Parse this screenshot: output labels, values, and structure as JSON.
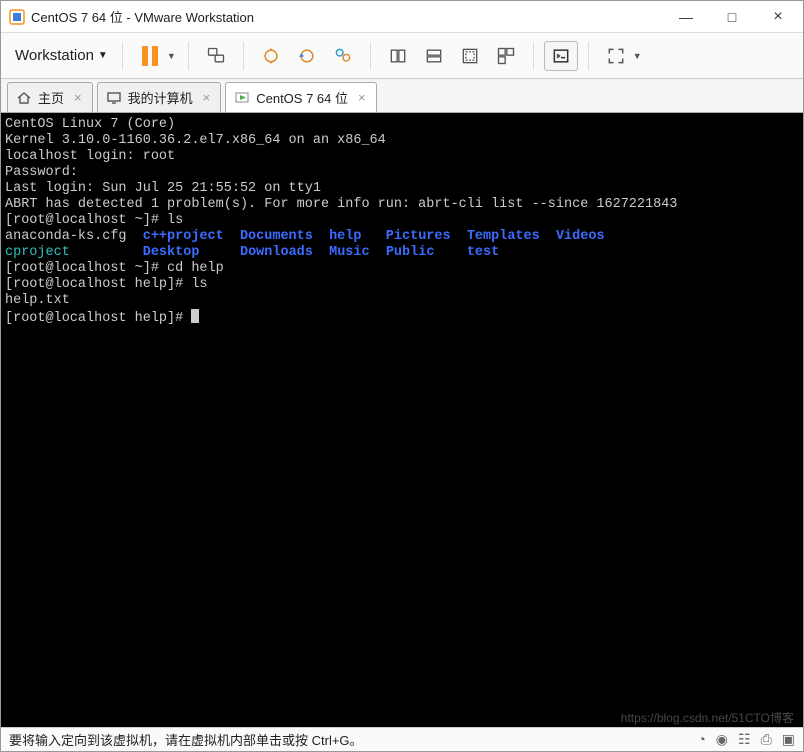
{
  "window": {
    "title": "CentOS 7 64 位 - VMware Workstation",
    "minimize": "—",
    "maximize": "□",
    "close": "×"
  },
  "menu": {
    "workstation_label": "Workstation"
  },
  "tabs": [
    {
      "label": "主页",
      "icon": "home"
    },
    {
      "label": "我的计算机",
      "icon": "monitor"
    },
    {
      "label": "CentOS 7 64 位",
      "icon": "vm",
      "active": true
    }
  ],
  "terminal": {
    "lines": [
      {
        "segs": [
          {
            "t": "CentOS Linux 7 (Core)"
          }
        ]
      },
      {
        "segs": [
          {
            "t": "Kernel 3.10.0-1160.36.2.el7.x86_64 on an x86_64"
          }
        ]
      },
      {
        "segs": [
          {
            "t": ""
          }
        ]
      },
      {
        "segs": [
          {
            "t": "localhost login: root"
          }
        ]
      },
      {
        "segs": [
          {
            "t": "Password:"
          }
        ]
      },
      {
        "segs": [
          {
            "t": "Last login: Sun Jul 25 21:55:52 on tty1"
          }
        ]
      },
      {
        "segs": [
          {
            "t": "ABRT has detected 1 problem(s). For more info run: abrt-cli list --since 1627221843"
          }
        ]
      },
      {
        "segs": [
          {
            "t": "[root@localhost ~]# ls"
          }
        ]
      },
      {
        "segs": [
          {
            "t": "anaconda-ks.cfg  "
          },
          {
            "t": "c++project",
            "c": "dir"
          },
          {
            "t": "  "
          },
          {
            "t": "Documents",
            "c": "dir"
          },
          {
            "t": "  "
          },
          {
            "t": "help",
            "c": "dir"
          },
          {
            "t": "   "
          },
          {
            "t": "Pictures",
            "c": "dir"
          },
          {
            "t": "  "
          },
          {
            "t": "Templates",
            "c": "dir"
          },
          {
            "t": "  "
          },
          {
            "t": "Videos",
            "c": "dir"
          }
        ]
      },
      {
        "segs": [
          {
            "t": "cproject",
            "c": "cy"
          },
          {
            "t": "         "
          },
          {
            "t": "Desktop",
            "c": "dir"
          },
          {
            "t": "     "
          },
          {
            "t": "Downloads",
            "c": "dir"
          },
          {
            "t": "  "
          },
          {
            "t": "Music",
            "c": "dir"
          },
          {
            "t": "  "
          },
          {
            "t": "Public",
            "c": "dir"
          },
          {
            "t": "    "
          },
          {
            "t": "test",
            "c": "dir"
          }
        ]
      },
      {
        "segs": [
          {
            "t": "[root@localhost ~]# cd help"
          }
        ]
      },
      {
        "segs": [
          {
            "t": "[root@localhost help]# ls"
          }
        ]
      },
      {
        "segs": [
          {
            "t": "help.txt"
          }
        ]
      },
      {
        "segs": [
          {
            "t": "[root@localhost help]# "
          },
          {
            "cursor": true
          }
        ]
      }
    ]
  },
  "statusbar": {
    "text": "要将输入定向到该虚拟机，请在虚拟机内部单击或按 Ctrl+G。"
  },
  "watermark": "https://blog.csdn.net/51CTO博客"
}
